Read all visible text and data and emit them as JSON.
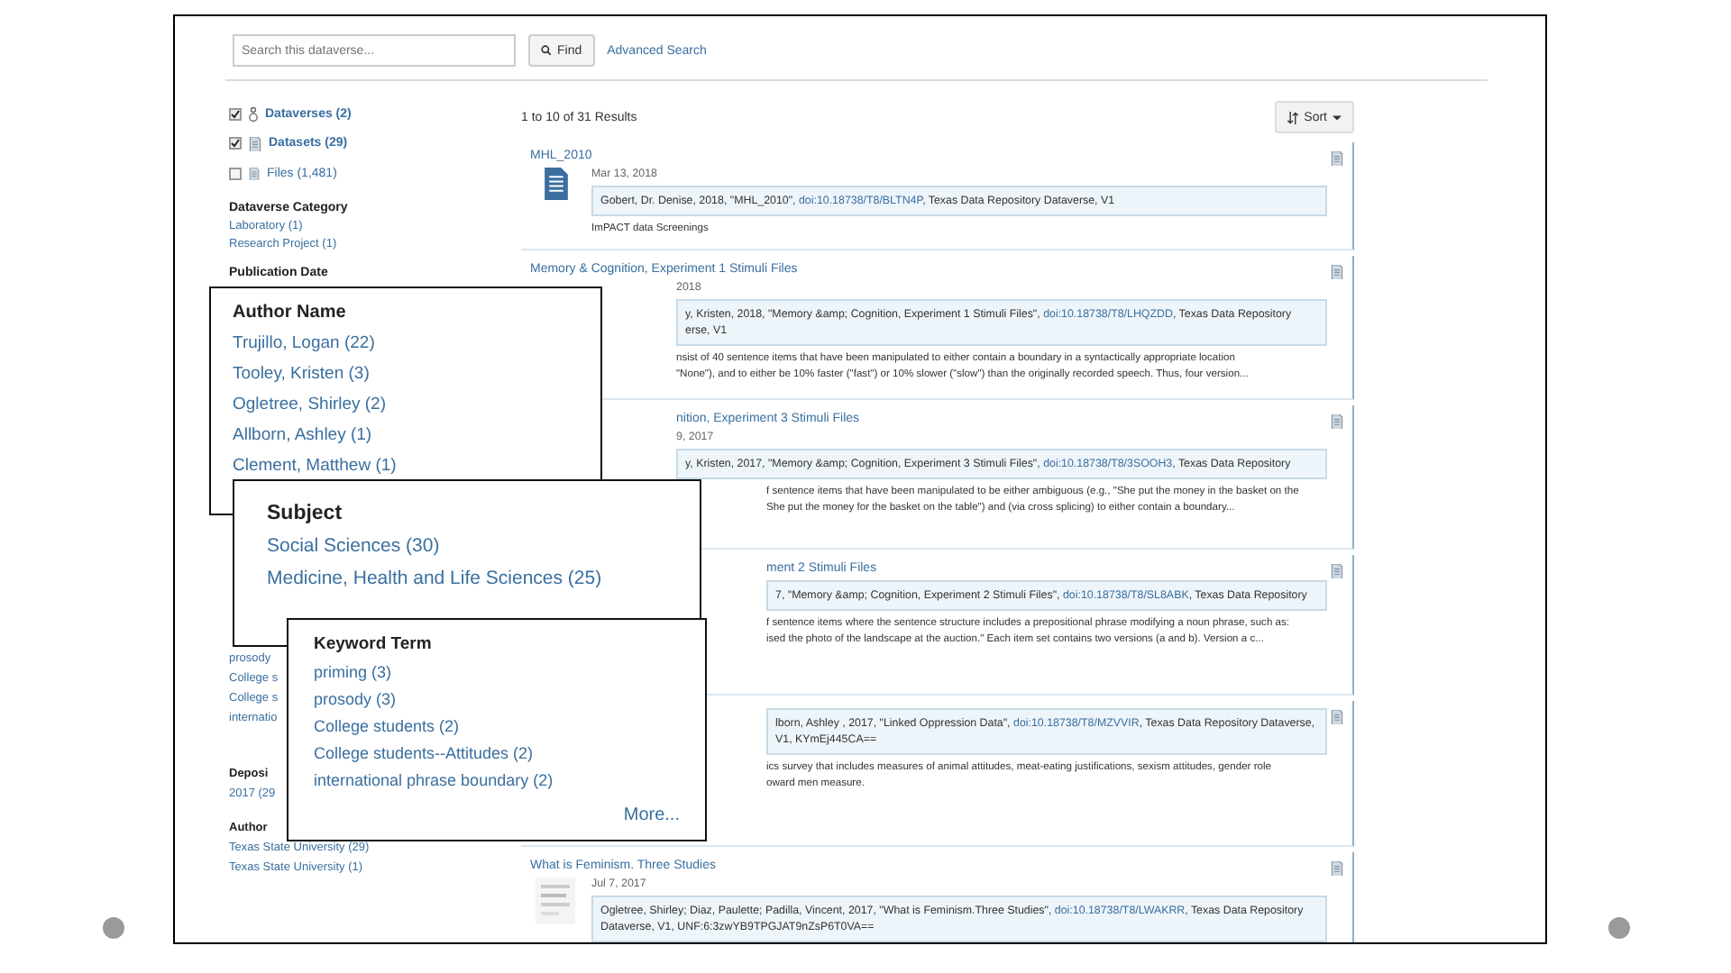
{
  "search": {
    "placeholder": "Search this dataverse...",
    "button": "Find",
    "advanced": "Advanced Search"
  },
  "types": [
    {
      "kind": "dataverse",
      "label": "Dataverses (2)",
      "checked": true
    },
    {
      "kind": "dataset",
      "label": "Datasets (29)",
      "checked": true
    },
    {
      "kind": "file",
      "label": "Files (1,481)",
      "checked": false
    }
  ],
  "facets": [
    {
      "title": "Dataverse Category",
      "items": [
        "Laboratory (1)",
        "Research Project (1)"
      ]
    },
    {
      "title": "Publication Date"
    }
  ],
  "sidebar_fragments": [
    "prosody",
    "College s",
    "College s",
    "internatio"
  ],
  "sidebar_fragments_2": [
    {
      "kind": "heading",
      "text": "Deposi"
    },
    {
      "kind": "item",
      "text": "2017 (29"
    },
    {
      "kind": "heading",
      "text": "Author"
    },
    {
      "kind": "item",
      "text": "Texas State University (29)"
    },
    {
      "kind": "item",
      "text": "Texas State University (1)"
    }
  ],
  "results": {
    "summary": "1 to 10 of 31 Results",
    "sort": "Sort",
    "cards": [
      {
        "kind": "dataset",
        "title": "MHL_2010",
        "date": "Mar 13, 2018",
        "citation": {
          "before": "Gobert, Dr. Denise, 2018, \"MHL_2010\", ",
          "doi": "doi:10.18738/T8/BLTN4P",
          "after": ", Texas Data Repository Dataverse, V1"
        },
        "description": [
          "ImPACT data Screenings"
        ]
      },
      {
        "kind": "partial",
        "title": "Memory & Cognition, Experiment 1 Stimuli Files",
        "date": "2018",
        "citation": {
          "before": "y, Kristen, 2018, \"Memory &amp; Cognition, Experiment 1 Stimuli Files\", ",
          "doi": "doi:10.18738/T8/LHQZDD",
          "after": ", Texas Data Repository erse, V1"
        },
        "description": [
          "nsist of 40 sentence items that have been manipulated to either contain a boundary in a syntactically appropriate location",
          "\"None\"), and to either be 10% faster (\"fast\") or 10% slower (\"slow\") than the originally recorded speech. Thus, four version..."
        ]
      },
      {
        "kind": "partial",
        "title": "nition, Experiment 3 Stimuli Files",
        "date": "9, 2017",
        "citation": {
          "before": "y, Kristen, 2017, \"Memory &amp; Cognition, Experiment 3 Stimuli Files\", ",
          "doi": "doi:10.18738/T8/3SOOH3",
          "after": ", Texas Data Repository"
        },
        "description": [
          "f sentence items that have been manipulated to be either ambiguous (e.g., \"She put the money in the basket on the",
          "She put the money for the basket on the table\") and (via cross splicing) to either contain a boundary..."
        ]
      },
      {
        "kind": "partial",
        "title": "ment 2 Stimuli Files",
        "citation": {
          "before": "7, \"Memory &amp; Cognition, Experiment 2 Stimuli Files\", ",
          "doi": "doi:10.18738/T8/SL8ABK",
          "after": ", Texas Data Repository"
        },
        "description": [
          "f sentence items where the sentence structure includes a prepositional phrase modifying a noun phrase, such as:",
          "ised the photo of the landscape at the auction.\" Each item set contains two versions (a and b). Version a c..."
        ]
      },
      {
        "kind": "partial",
        "citation": {
          "before": "lborn, Ashley , 2017, \"Linked Oppression Data\", ",
          "doi": "doi:10.18738/T8/MZVVIR",
          "after": ", Texas Data Repository Dataverse, V1, KYmEj445CA=="
        },
        "description": [
          "ics survey that includes measures of animal attitudes, meat-eating justifications, sexism attitudes, gender role",
          "oward men measure."
        ]
      },
      {
        "kind": "thumbnail",
        "title": "What is Feminism. Three Studies",
        "date": "Jul 7, 2017",
        "citation": {
          "before": "Ogletree, Shirley; Diaz, Paulette; Padilla, Vincent, 2017, \"What is Feminism.Three Studies\", ",
          "doi": "doi:10.18738/T8/LWAKRR",
          "after": ", Texas Data Repository Dataverse, V1, UNF:6:3zwYB9TPGJAT9nZsP6T0VA=="
        }
      }
    ]
  },
  "callouts": [
    {
      "title": "Author Name",
      "items": [
        "Trujillo, Logan (22)",
        "Tooley, Kristen (3)",
        "Ogletree, Shirley (2)",
        "Allborn, Ashley (1)",
        "Clement, Matthew (1)"
      ]
    },
    {
      "title": "Subject",
      "items": [
        "Social Sciences (30)",
        "Medicine, Health and Life Sciences (25)"
      ]
    },
    {
      "title": "Keyword Term",
      "items": [
        "priming (3)",
        "prosody (3)",
        "College students (2)",
        "College students--Attitudes (2)",
        "international phrase boundary (2)"
      ],
      "more": "More..."
    }
  ]
}
